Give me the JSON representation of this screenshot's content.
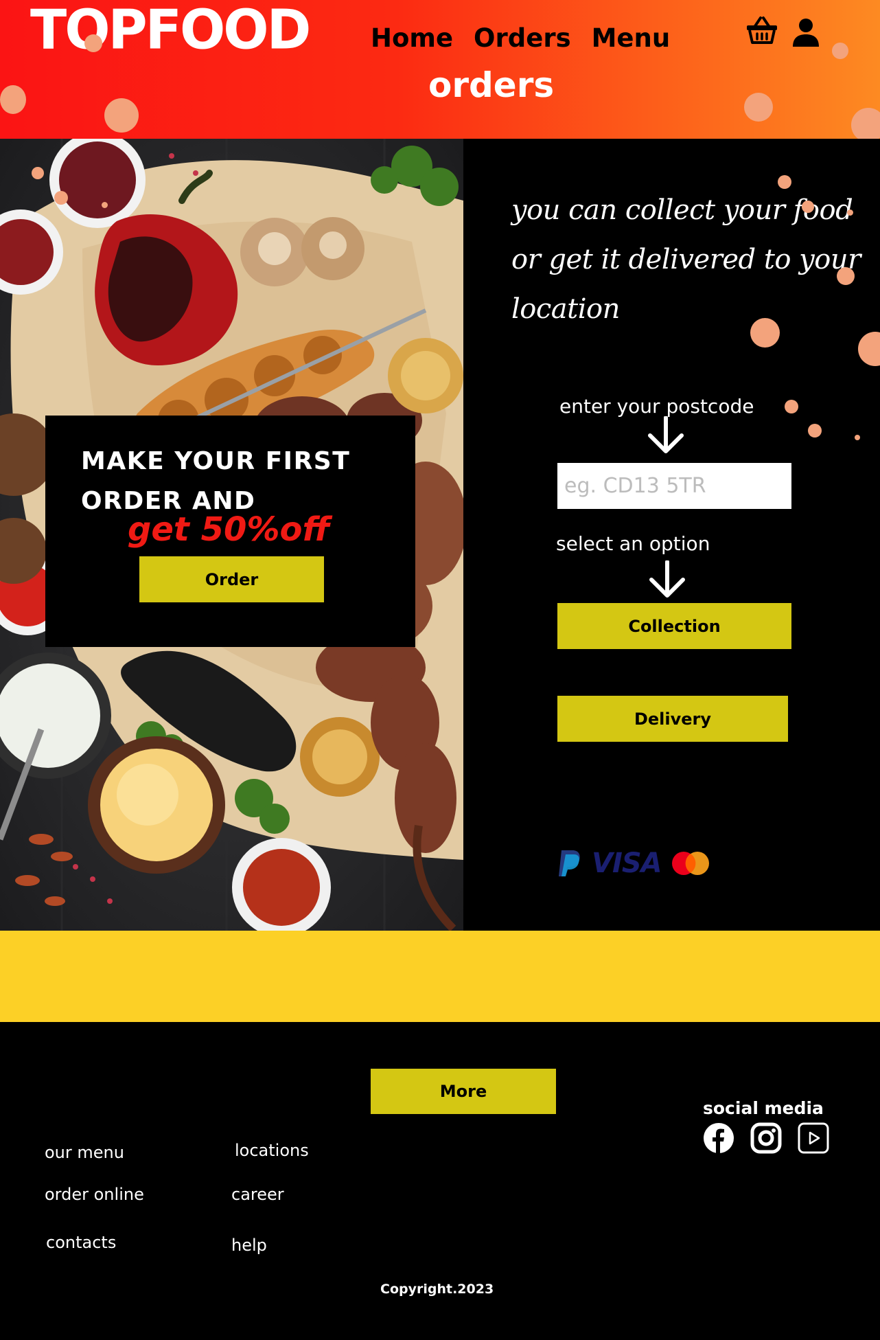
{
  "header": {
    "logo": "TOPFOOD",
    "nav": [
      "Home",
      "Orders",
      "Menu"
    ],
    "page_title": "orders",
    "icons": [
      "basket-icon",
      "user-icon"
    ]
  },
  "promo": {
    "title": "MAKE YOUR FIRST ORDER AND",
    "highlight": "get 50%off",
    "order_button": "Order"
  },
  "ordering": {
    "tagline": "you can collect your food or get it delivered to your location",
    "postcode_label": "enter your postcode",
    "postcode_placeholder": "eg. CD13 5TR",
    "option_label": "select an option",
    "collection_button": "Collection",
    "delivery_button": "Delivery",
    "payment_methods": [
      "paypal",
      "VISA",
      "mastercard"
    ]
  },
  "footer": {
    "more_button": "More",
    "links_col1": [
      "our menu",
      "order online",
      "contacts"
    ],
    "links_col2": [
      "locations",
      "career",
      "help"
    ],
    "social_title": "social media",
    "social_icons": [
      "facebook-icon",
      "instagram-icon",
      "youtube-icon"
    ],
    "copyright": "Copyright.2023"
  },
  "colors": {
    "header_gradient_start": "#fb1414",
    "header_gradient_end": "#fd8a22",
    "button_yellow": "#d4c713",
    "band_yellow": "#fcd026",
    "promo_red": "#f01a14",
    "dot_peach": "#f3a37c"
  }
}
